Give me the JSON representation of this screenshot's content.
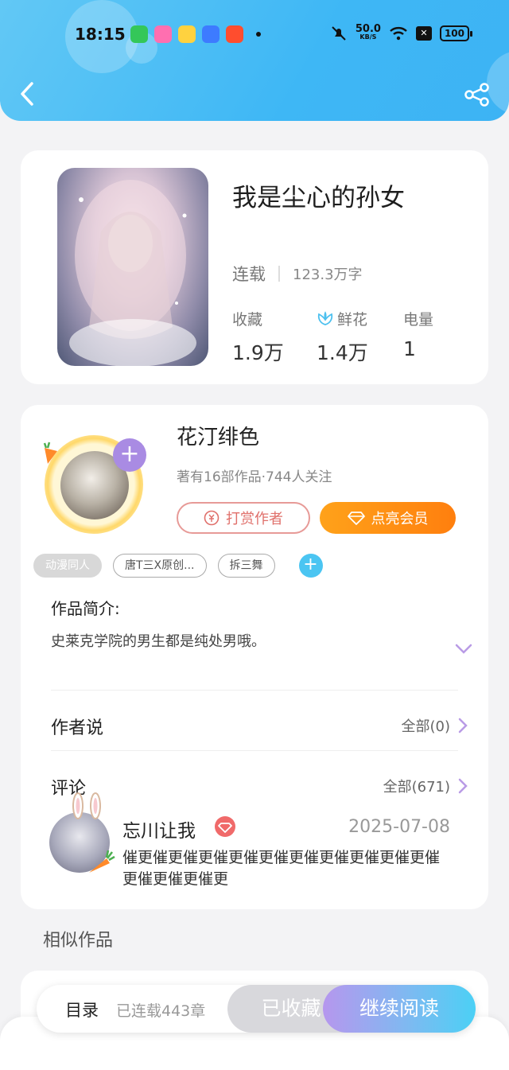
{
  "status_bar": {
    "time": "18:15",
    "net_speed": "50.0",
    "net_unit": "KB/S",
    "battery": "100"
  },
  "book": {
    "title": "我是尘心的孙女",
    "status": "连载",
    "word_count": "123.3万字",
    "stats": [
      {
        "label": "收藏",
        "value": "1.9万"
      },
      {
        "label": "鲜花",
        "value": "1.4万"
      },
      {
        "label": "电量",
        "value": "1"
      }
    ]
  },
  "author": {
    "name": "花汀绯色",
    "meta": "著有16部作品·744人关注",
    "tip_button": "打赏作者",
    "vip_button": "点亮会员"
  },
  "tags": [
    "动漫同人",
    "唐T三X原创...",
    "拆三舞"
  ],
  "intro": {
    "title": "作品简介:",
    "text": "史莱克学院的男生都是纯处男哦。"
  },
  "author_says": {
    "title": "作者说",
    "all": "全部(0)"
  },
  "comments": {
    "title": "评论",
    "all": "全部(671)",
    "first": {
      "user": "忘川让我",
      "date": "2025-07-08",
      "text": "催更催更催更催更催更催更催更催更催更催更催更催更催更催更"
    }
  },
  "similar_title": "相似作品",
  "bottom_bar": {
    "toc": "目录",
    "chapters": "已连载443章",
    "collected": "已收藏",
    "continue": "继续阅读"
  },
  "colors": {
    "header_blue": "#3eb7f5",
    "accent_orange": "#ff8a14",
    "accent_purple": "#a98be3"
  }
}
